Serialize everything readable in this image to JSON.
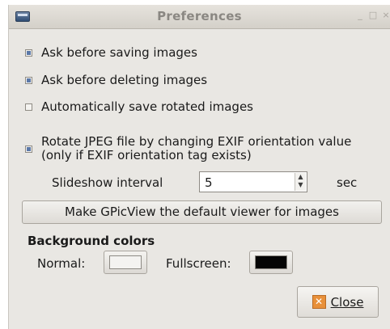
{
  "window": {
    "title": "Preferences",
    "controls": {
      "minimize": "_",
      "maximize": "□",
      "close": "×"
    }
  },
  "options": [
    {
      "label": "Ask before saving images",
      "checked": true
    },
    {
      "label": "Ask before deleting images",
      "checked": true
    },
    {
      "label": "Automatically save rotated images",
      "checked": false
    }
  ],
  "rotate_option": {
    "line1": "Rotate JPEG file by changing EXIF orientation value",
    "line2": "(only if EXIF orientation tag exists)",
    "checked": true
  },
  "slideshow": {
    "label": "Slideshow interval",
    "value": "5",
    "unit": "sec"
  },
  "default_viewer_button": "Make GPicView the default viewer for images",
  "background_colors": {
    "title": "Background colors",
    "normal_label": "Normal:",
    "normal_color": "#f4f3f1",
    "fullscreen_label": "Fullscreen:",
    "fullscreen_color": "#050505"
  },
  "close_button": {
    "label": "Close",
    "icon": "close-icon"
  }
}
